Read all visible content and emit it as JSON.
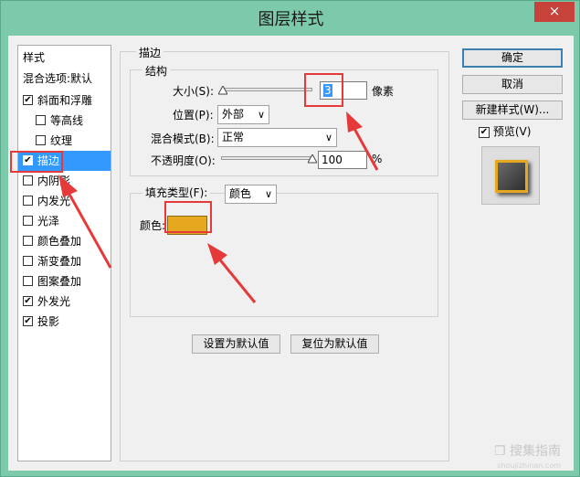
{
  "window": {
    "title": "图层样式",
    "close": "×"
  },
  "stylelist": {
    "header": "样式",
    "items": [
      {
        "label": "混合选项:默认",
        "checkbox": false
      },
      {
        "label": "斜面和浮雕",
        "checkbox": true,
        "checked": true
      },
      {
        "label": "等高线",
        "checkbox": true,
        "checked": false,
        "indent": true
      },
      {
        "label": "纹理",
        "checkbox": true,
        "checked": false,
        "indent": true
      },
      {
        "label": "描边",
        "checkbox": true,
        "checked": true,
        "selected": true
      },
      {
        "label": "内阴影",
        "checkbox": true,
        "checked": false
      },
      {
        "label": "内发光",
        "checkbox": true,
        "checked": false
      },
      {
        "label": "光泽",
        "checkbox": true,
        "checked": false
      },
      {
        "label": "颜色叠加",
        "checkbox": true,
        "checked": false
      },
      {
        "label": "渐变叠加",
        "checkbox": true,
        "checked": false
      },
      {
        "label": "图案叠加",
        "checkbox": true,
        "checked": false
      },
      {
        "label": "外发光",
        "checkbox": true,
        "checked": true
      },
      {
        "label": "投影",
        "checkbox": true,
        "checked": true
      }
    ]
  },
  "stroke": {
    "group_label": "描边",
    "structure_label": "结构",
    "size_label": "大小(S):",
    "size_value": "3",
    "size_unit": "像素",
    "position_label": "位置(P):",
    "position_value": "外部",
    "blend_label": "混合模式(B):",
    "blend_value": "正常",
    "opacity_label": "不透明度(O):",
    "opacity_value": "100",
    "opacity_unit": "%",
    "fill_type_label": "填充类型(F):",
    "fill_type_value": "颜色",
    "color_label": "颜色:",
    "color_hex": "#e6a81f"
  },
  "bottom_buttons": {
    "set_default": "设置为默认值",
    "reset_default": "复位为默认值"
  },
  "right_panel": {
    "ok": "确定",
    "cancel": "取消",
    "new_style": "新建样式(W)...",
    "preview_label": "预览(V)",
    "preview_checked": true
  },
  "watermark": {
    "text": "❐ 搜集指南",
    "url": "shoujizhinan.com"
  },
  "colors": {
    "accent": "#3399ff",
    "annotation": "#e63a3a",
    "window_frame": "#7ccaa9"
  }
}
